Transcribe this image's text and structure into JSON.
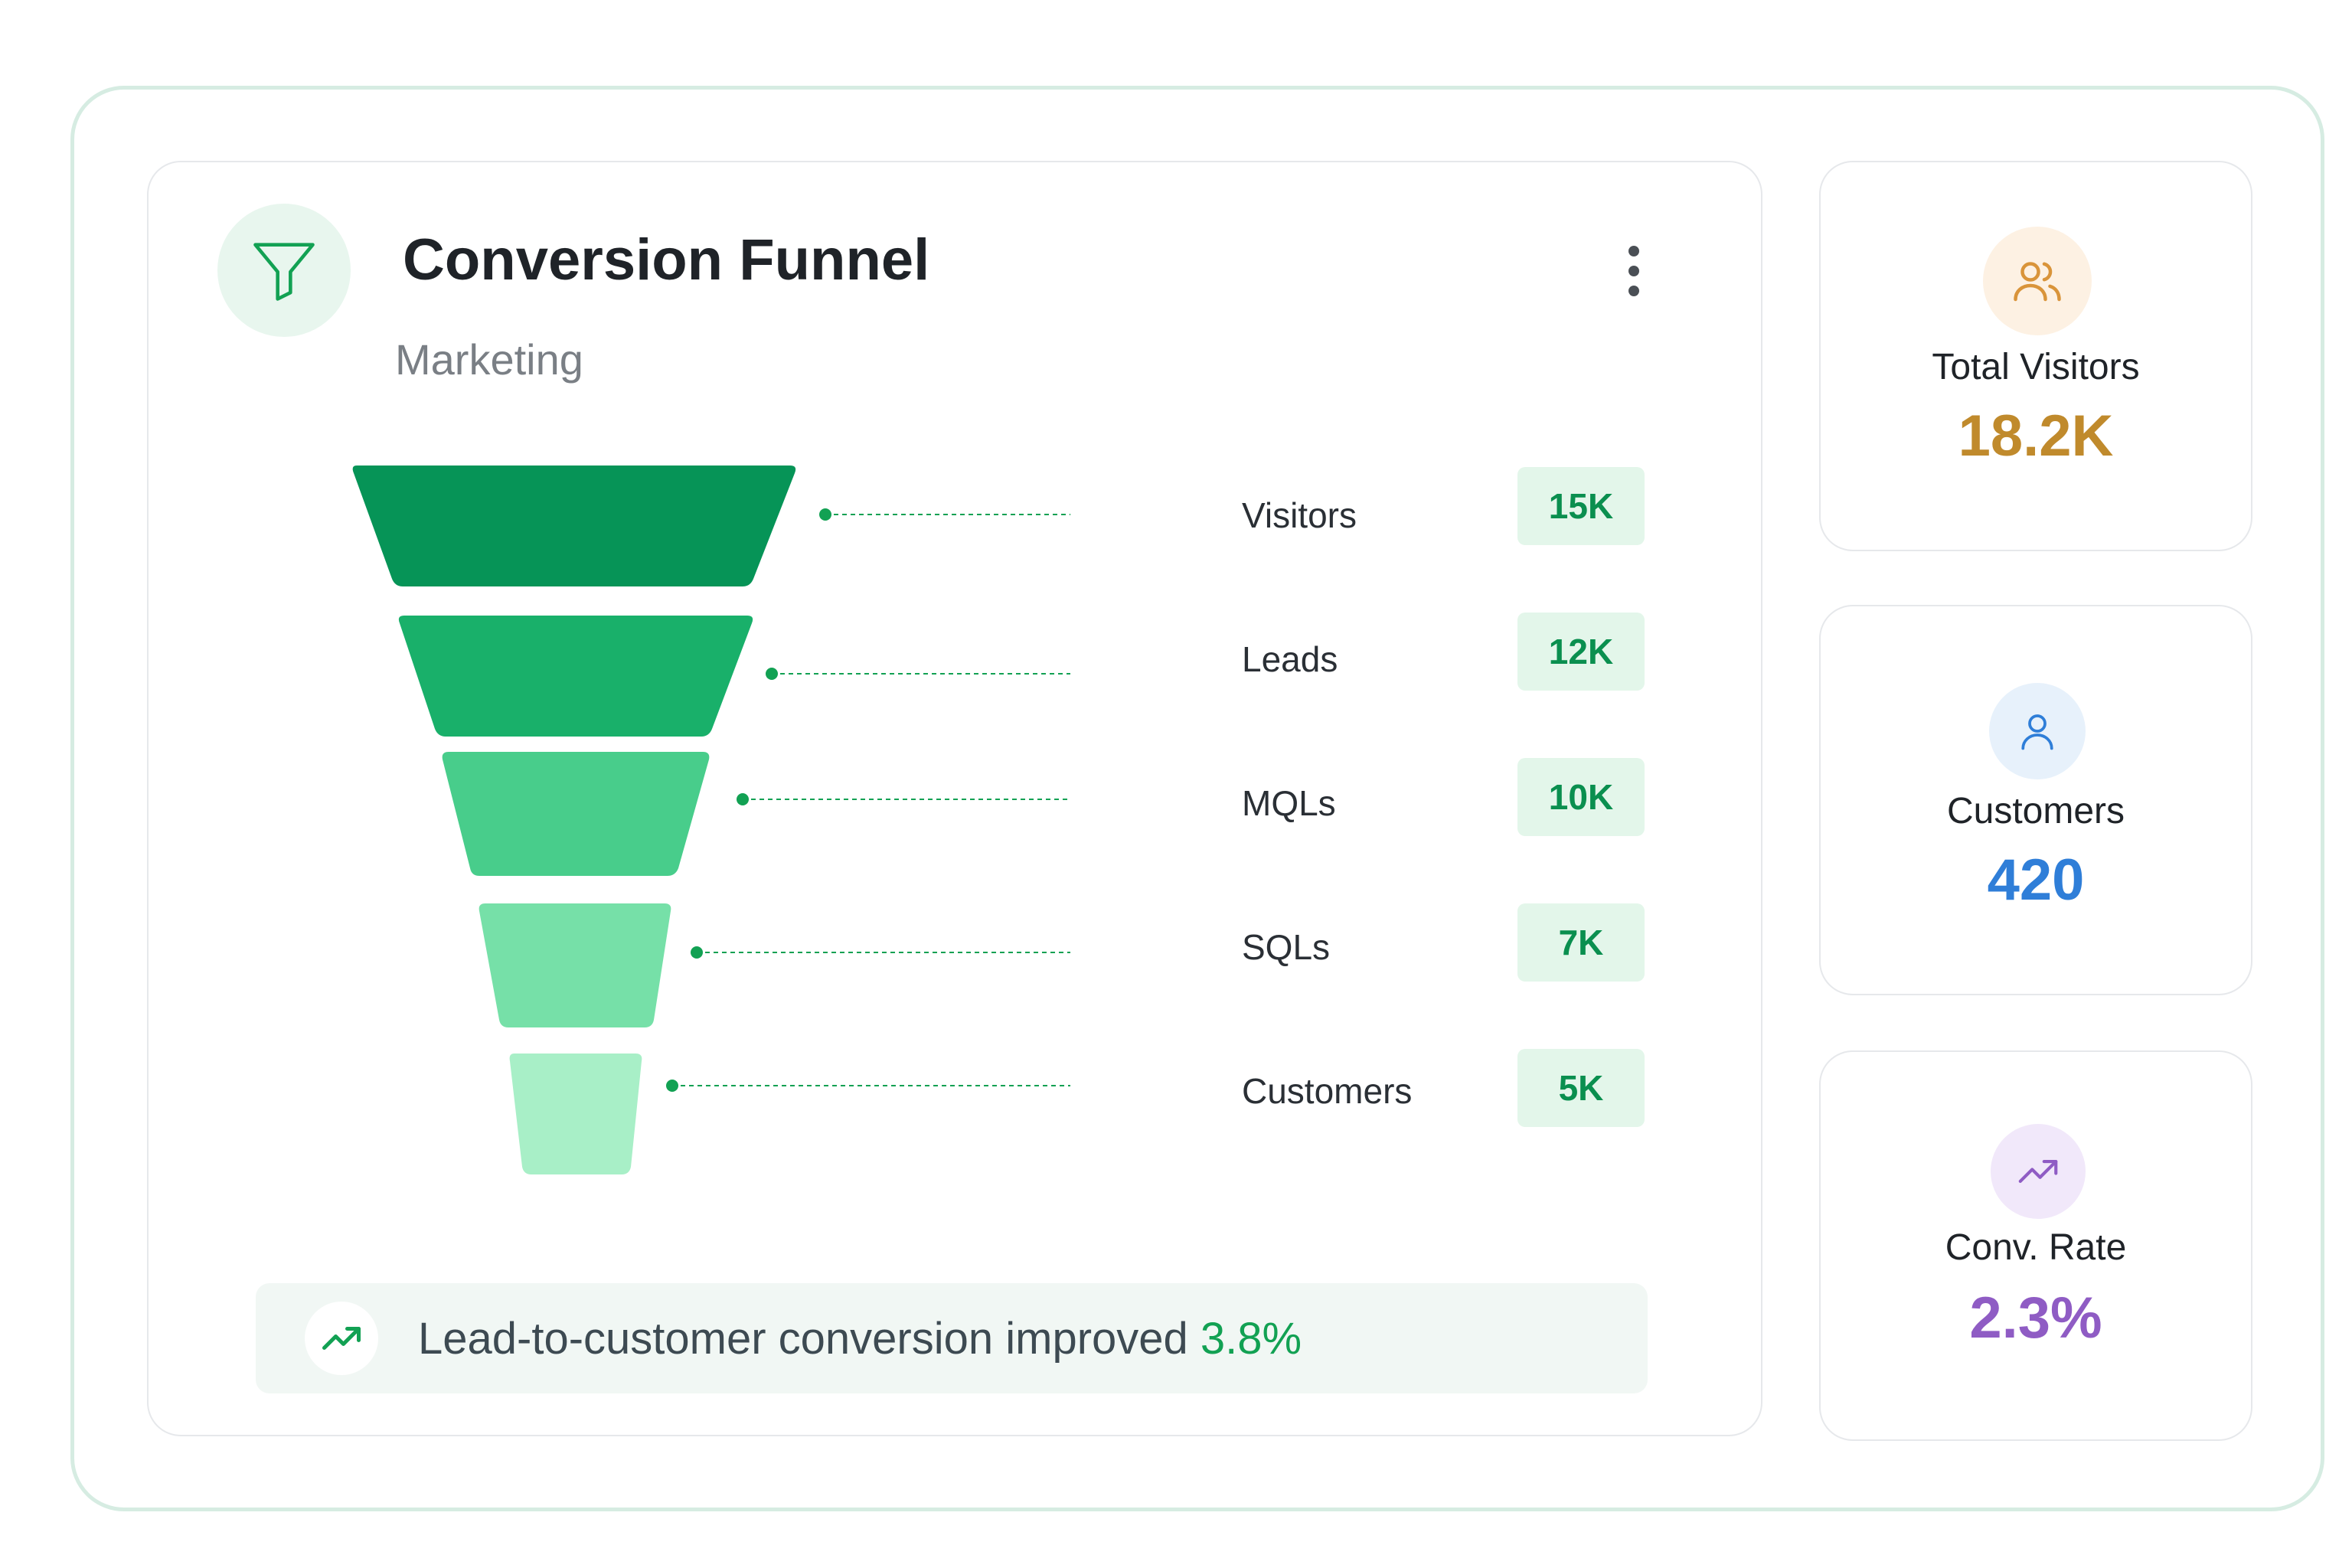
{
  "header": {
    "title": "Conversion Funnel",
    "subtitle": "Marketing",
    "icon": "funnel-icon",
    "menu_icon": "more-vertical-icon"
  },
  "funnel": {
    "stages": [
      {
        "label": "Visitors",
        "value": "15K",
        "color": "#069457"
      },
      {
        "label": "Leads",
        "value": "12K",
        "color": "#19b06a"
      },
      {
        "label": "MQLs",
        "value": "10K",
        "color": "#48cd8b"
      },
      {
        "label": "SQLs",
        "value": "7K",
        "color": "#76e0a8"
      },
      {
        "label": "Customers",
        "value": "5K",
        "color": "#a8efc7"
      }
    ],
    "leader_color": "#12a153"
  },
  "insight": {
    "icon": "trending-up-icon",
    "text": "Lead-to-customer conversion improved ",
    "value": "3.8%"
  },
  "stats": [
    {
      "label": "Total Visitors",
      "value": "18.2K",
      "icon": "users-icon",
      "color": "#c08a2c",
      "icon_bg": "#fdf1e3"
    },
    {
      "label": "Customers",
      "value": "420",
      "icon": "user-icon",
      "color": "#2f7ed8",
      "icon_bg": "#e7f1fb"
    },
    {
      "label": "Conv. Rate",
      "value": "2.3%",
      "icon": "trending-up-icon",
      "color": "#8f5cc4",
      "icon_bg": "#f1e8fa"
    }
  ],
  "colors": {
    "accent": "#12a153",
    "frame_border": "#d6ece2"
  }
}
